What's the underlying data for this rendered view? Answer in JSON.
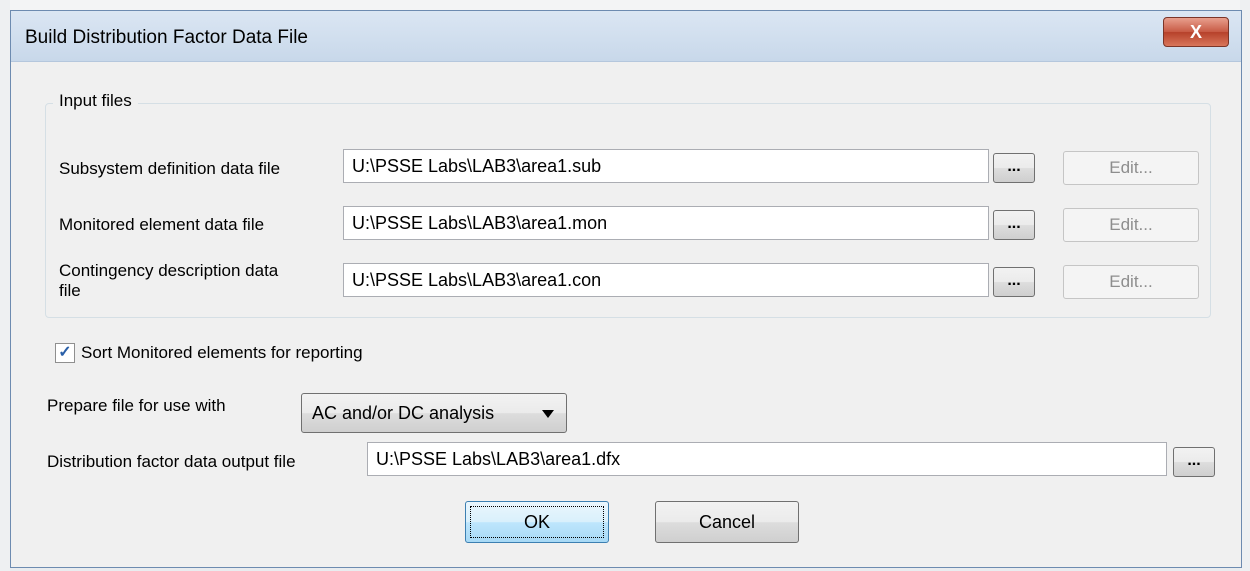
{
  "window": {
    "title": "Build Distribution Factor Data File",
    "close_glyph": "X"
  },
  "input_files": {
    "group_label": "Input files",
    "rows": [
      {
        "label": "Subsystem definition data file",
        "value": "U:\\PSSE Labs\\LAB3\\area1.sub",
        "browse": "...",
        "edit": "Edit..."
      },
      {
        "label": "Monitored element data file",
        "value": "U:\\PSSE Labs\\LAB3\\area1.mon",
        "browse": "...",
        "edit": "Edit..."
      },
      {
        "label_line1": "Contingency description data",
        "label_line2": "file",
        "value": "U:\\PSSE Labs\\LAB3\\area1.con",
        "browse": "...",
        "edit": "Edit..."
      }
    ]
  },
  "sort_option": {
    "label": "Sort Monitored elements for reporting",
    "checked": true,
    "check_glyph": "✓"
  },
  "prepare": {
    "label": "Prepare file for use with",
    "selected": "AC and/or DC analysis"
  },
  "output": {
    "label": "Distribution factor data output file",
    "value": "U:\\PSSE Labs\\LAB3\\area1.dfx",
    "browse": "..."
  },
  "buttons": {
    "ok": "OK",
    "cancel": "Cancel"
  },
  "colors": {
    "title_bar": "#c8d8ea",
    "close_button": "#c75a44",
    "dialog_bg": "#f0f0f0"
  }
}
